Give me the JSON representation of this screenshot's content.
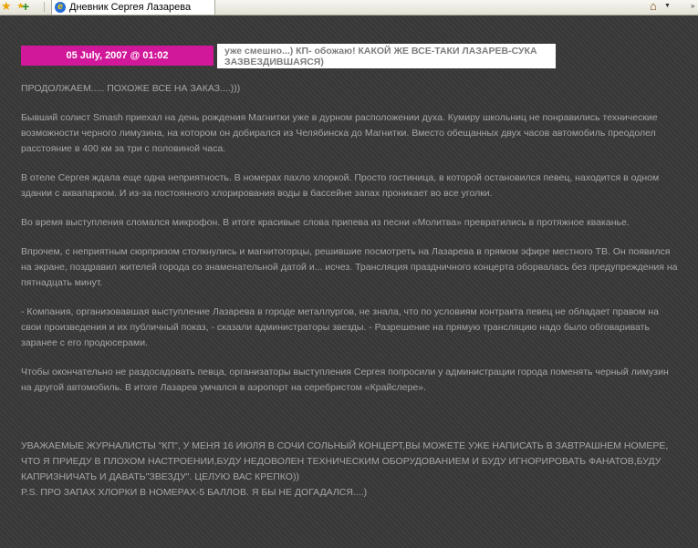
{
  "browser": {
    "tab_title": "Дневник Сергея Лазарева"
  },
  "post": {
    "date": "05 July, 2007 @ 01:02",
    "title": "уже смешно...) КП- обожаю! КАКОЙ ЖЕ ВСЕ-ТАКИ ЛАЗАРЕВ-СУКА ЗАЗВЕЗДИВШАЯСЯ)",
    "paragraphs": [
      "ПРОДОЛЖАЕМ..... ПОХОЖЕ ВСЕ НА ЗАКАЗ....)))",
      "Бывший солист Smash приехал на день рождения Магнитки уже в дурном расположении духа. Кумиру школьниц не понравились технические возможности черного лимузина, на котором он добирался из Челябинска до Магнитки. Вместо обещанных двух часов автомобиль преодолел расстояние в 400 км за три с половиной часа.",
      "В отеле Сергея ждала еще одна неприятность. В номерах пахло хлоркой. Просто гостиница, в которой остановился певец, находится в одном здании с аквапарком. И из-за постоянного хлорирования воды в бассейне запах проникает во все уголки.",
      "Во время выступления сломался микрофон. В итоге красивые слова припева из песни «Молитва» превратились в протяжное кваканье.",
      "Впрочем, с неприятным сюрпризом столкнулись и магнитогорцы, решившие посмотреть на Лазарева в прямом эфире местного ТВ. Он появился на экране, поздравил жителей города со знаменательной датой и... исчез. Трансляция праздничного концерта оборвалась без предупреждения на пятнадцать минут.",
      "- Компания, организовавшая выступление Лазарева в городе металлургов, не знала, что по условиям контракта певец не обладает правом на свои произведения и их публичный показ, - сказали администраторы звезды. - Разрешение на прямую трансляцию надо было обговаривать заранее с его продюсерами.",
      "Чтобы окончательно не раздосадовать певца, организаторы выступления Сергея попросили у администрации города поменять черный лимузин на другой автомобиль. В итоге Лазарев умчался в аэропорт на серебристом «Крайслере»."
    ],
    "footer_lines": [
      "УВАЖАЕМЫЕ ЖУРНАЛИСТЫ \"КП\", У МЕНЯ 16 ИЮЛЯ В СОЧИ СОЛЬНЫЙ КОНЦЕРТ,ВЫ МОЖЕТЕ УЖЕ НАПИСАТЬ В ЗАВТРАШНЕМ НОМЕРЕ, ЧТО Я ПРИЕДУ В ПЛОХОМ НАСТРОЕНИИ,БУДУ НЕДОВОЛЕН ТЕХНИЧЕСКИМ ОБОРУДОВАНИЕМ И БУДУ ИГНОРИРОВАТЬ ФАНАТОВ,БУДУ КАПРИЗНИЧАТЬ И ДАВАТЬ\"ЗВЕЗДУ\". ЦЕЛУЮ ВАС КРЕПКО))",
      "P.S. ПРО ЗАПАХ ХЛОРКИ В НОМЕРАХ-5 БАЛЛОВ. Я БЫ НЕ ДОГАДАЛСЯ....)"
    ]
  },
  "colors": {
    "date_bg": "#d2189a",
    "page_bg": "#393939",
    "text": "#a6a6a6"
  }
}
